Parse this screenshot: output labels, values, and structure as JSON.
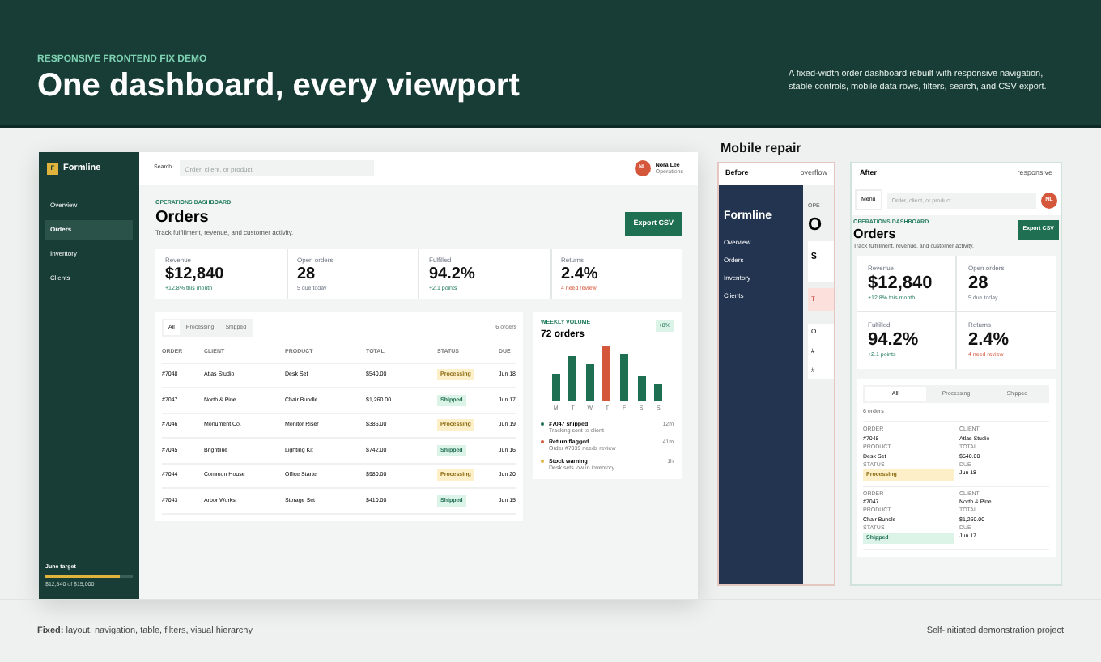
{
  "header": {
    "eyebrow": "RESPONSIVE FRONTEND FIX DEMO",
    "title": "One dashboard, every viewport",
    "description": "A fixed-width order dashboard rebuilt with responsive navigation, stable controls, mobile data rows, filters, search, and CSV export."
  },
  "desktop": {
    "brand": {
      "mark": "F",
      "name": "Formline"
    },
    "nav": [
      {
        "label": "Overview",
        "selected": false
      },
      {
        "label": "Orders",
        "selected": true
      },
      {
        "label": "Inventory",
        "selected": false
      },
      {
        "label": "Clients",
        "selected": false
      }
    ],
    "target": {
      "label": "June target",
      "level": 0.86,
      "reading": "$12,840 of $15,000"
    },
    "search": {
      "label": "Search",
      "placeholder": "Order, client, or product"
    },
    "user": {
      "initials": "NL",
      "name": "Nora Lee",
      "role": "Operations"
    },
    "eyebrow": "OPERATIONS DASHBOARD",
    "title": "Orders",
    "subtitle": "Track fulfillment, revenue, and customer activity.",
    "export": "Export CSV",
    "kpis": [
      {
        "label": "Revenue",
        "value": "$12,840",
        "note": "+12.8% this month",
        "kind": "up"
      },
      {
        "label": "Open orders",
        "value": "28",
        "note": "5 due today",
        "kind": "neutral"
      },
      {
        "label": "Fulfilled",
        "value": "94.2%",
        "note": "+2.1 points",
        "kind": "up"
      },
      {
        "label": "Returns",
        "value": "2.4%",
        "note": "4 need review",
        "kind": "down"
      }
    ],
    "filters": [
      {
        "label": "All",
        "selected": true
      },
      {
        "label": "Processing",
        "selected": false
      },
      {
        "label": "Shipped",
        "selected": false
      }
    ],
    "count": "6 orders",
    "columns": [
      "ORDER",
      "CLIENT",
      "PRODUCT",
      "TOTAL",
      "STATUS",
      "DUE"
    ],
    "rows": [
      {
        "order": "#7048",
        "client": "Atlas Studio",
        "product": "Desk Set",
        "total": "$540.00",
        "status": "Processing",
        "kind": "processing",
        "due": "Jun 18"
      },
      {
        "order": "#7047",
        "client": "North & Pine",
        "product": "Chair Bundle",
        "total": "$1,260.00",
        "status": "Shipped",
        "kind": "shipped",
        "due": "Jun 17"
      },
      {
        "order": "#7046",
        "client": "Monument Co.",
        "product": "Monitor Riser",
        "total": "$386.00",
        "status": "Processing",
        "kind": "processing",
        "due": "Jun 19"
      },
      {
        "order": "#7045",
        "client": "Brightline",
        "product": "Lighting Kit",
        "total": "$742.00",
        "status": "Shipped",
        "kind": "shipped",
        "due": "Jun 16"
      },
      {
        "order": "#7044",
        "client": "Common House",
        "product": "Office Starter",
        "total": "$980.00",
        "status": "Processing",
        "kind": "processing",
        "due": "Jun 20"
      },
      {
        "order": "#7043",
        "client": "Arbor Works",
        "product": "Storage Set",
        "total": "$410.00",
        "status": "Shipped",
        "kind": "shipped",
        "due": "Jun 15"
      }
    ],
    "volume": {
      "eyebrow": "WEEKLY VOLUME",
      "title": "72 orders",
      "badge": "+8%",
      "days": [
        {
          "label": "M",
          "highlighted": false
        },
        {
          "label": "T",
          "highlighted": false
        },
        {
          "label": "W",
          "highlighted": false
        },
        {
          "label": "T",
          "highlighted": true
        },
        {
          "label": "F",
          "highlighted": false
        },
        {
          "label": "S",
          "highlighted": false
        },
        {
          "label": "S",
          "highlighted": false
        }
      ],
      "activity": [
        {
          "title": "#7047 shipped",
          "detail": "Tracking sent to client",
          "time": "12m",
          "color": "#1f6f52"
        },
        {
          "title": "Return flagged",
          "detail": "Order #7039 needs review",
          "time": "41m",
          "color": "#d5573b"
        },
        {
          "title": "Stock warning",
          "detail": "Desk sets low in inventory",
          "time": "1h",
          "color": "#e0b43c"
        }
      ]
    }
  },
  "mobile": {
    "title": "Mobile repair",
    "before": {
      "label": "Before",
      "note": "overflow",
      "brand": "Formline",
      "nav": [
        "Overview",
        "Orders",
        "Inventory",
        "Clients"
      ],
      "eyebrow": "OPE",
      "heading": "O",
      "card": "$",
      "alert": "T",
      "list": [
        "O",
        "#",
        "#"
      ]
    },
    "after": {
      "label": "After",
      "note": "responsive",
      "menu": "Menu",
      "placeholder": "Order, client, or product",
      "initials": "NL",
      "eyebrow": "OPERATIONS DASHBOARD",
      "title": "Orders",
      "subtitle": "Track fulfillment, revenue, and customer activity.",
      "export": "Export CSV",
      "kpis": [
        {
          "label": "Revenue",
          "value": "$12,840",
          "note": "+12.8% this month",
          "kind": "up"
        },
        {
          "label": "Open orders",
          "value": "28",
          "note": "5 due today",
          "kind": "neutral"
        },
        {
          "label": "Fulfilled",
          "value": "94.2%",
          "note": "+2.1 points",
          "kind": "up"
        },
        {
          "label": "Returns",
          "value": "2.4%",
          "note": "4 need review",
          "kind": "down"
        }
      ],
      "filters": [
        {
          "label": "All",
          "selected": true
        },
        {
          "label": "Processing",
          "selected": false
        },
        {
          "label": "Shipped",
          "selected": false
        }
      ],
      "count": "6 orders",
      "cards": [
        {
          "fields": [
            {
              "label": "ORDER",
              "value": "#7048"
            },
            {
              "label": "CLIENT",
              "value": "Atlas Studio"
            },
            {
              "label": "PRODUCT",
              "value": "Desk Set"
            },
            {
              "label": "TOTAL",
              "value": "$540.00"
            },
            {
              "label": "STATUS",
              "value": "Processing",
              "kind": "processing"
            },
            {
              "label": "DUE",
              "value": "Jun 18"
            }
          ]
        },
        {
          "fields": [
            {
              "label": "ORDER",
              "value": "#7047"
            },
            {
              "label": "CLIENT",
              "value": "North & Pine"
            },
            {
              "label": "PRODUCT",
              "value": "Chair Bundle"
            },
            {
              "label": "TOTAL",
              "value": "$1,260.00"
            },
            {
              "label": "STATUS",
              "value": "Shipped",
              "kind": "shipped"
            },
            {
              "label": "DUE",
              "value": "Jun 17"
            }
          ]
        }
      ]
    }
  },
  "footer": {
    "fixed": "**Fixed:** layout, navigation, table, filters, visual hierarchy",
    "credit": "Self-initiated demonstration project"
  }
}
